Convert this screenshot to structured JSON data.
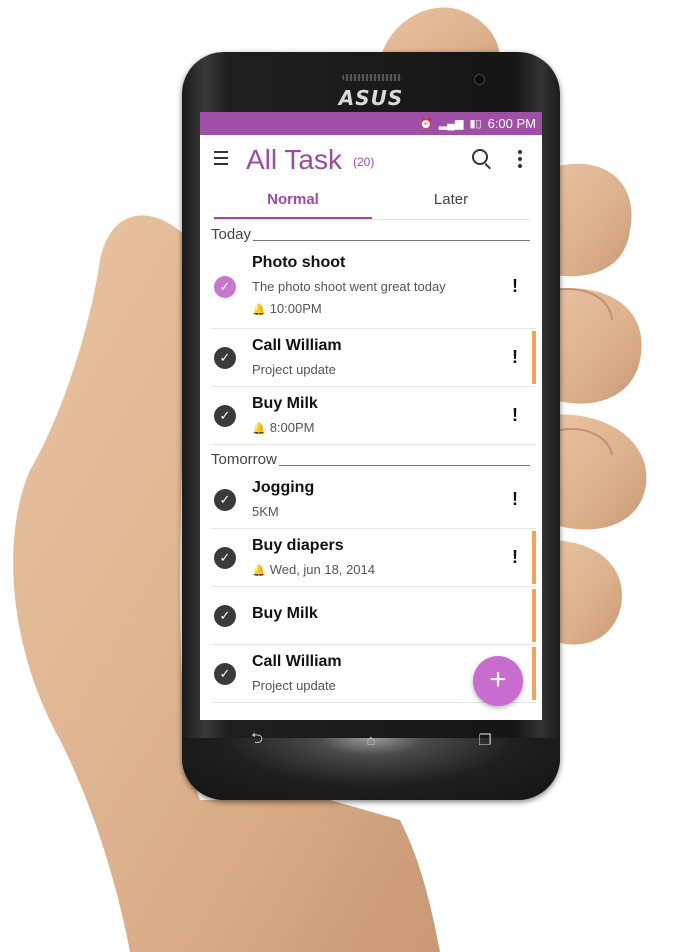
{
  "device": {
    "brand_logo": "ASUS"
  },
  "status_bar": {
    "time": "6:00 PM",
    "icons": [
      "alarm-icon",
      "signal-icon",
      "battery-icon"
    ]
  },
  "app_bar": {
    "title": "All Task",
    "count": "(20)",
    "icons": [
      "menu-icon",
      "search-icon",
      "more-icon"
    ]
  },
  "tabs": [
    {
      "label": "Normal",
      "active": true
    },
    {
      "label": "Later",
      "active": false
    }
  ],
  "sections": [
    {
      "title": "Today",
      "tasks": [
        {
          "name": "Photo shoot",
          "note": "The photo shoot went great today",
          "reminder": "10:00PM",
          "done_style": "purple",
          "flag": "!",
          "accent": false
        },
        {
          "name": "Call William",
          "note": "Project update",
          "reminder": "",
          "done_style": "dark",
          "flag": "!",
          "accent": true
        },
        {
          "name": "Buy Milk",
          "note": "",
          "reminder": "8:00PM",
          "done_style": "dark",
          "flag": "!",
          "accent": false
        }
      ]
    },
    {
      "title": "Tomorrow",
      "tasks": [
        {
          "name": "Jogging",
          "note": "5KM",
          "reminder": "",
          "done_style": "dark",
          "flag": "!",
          "accent": false
        },
        {
          "name": "Buy diapers",
          "note": "",
          "reminder": "Wed, jun 18, 2014",
          "done_style": "dark",
          "flag": "!",
          "accent": true
        },
        {
          "name": "Buy Milk",
          "note": "",
          "reminder": "",
          "done_style": "dark",
          "flag": "",
          "accent": true
        },
        {
          "name": "Call William",
          "note": "Project update",
          "reminder": "",
          "done_style": "dark",
          "flag": "!",
          "accent": true
        }
      ]
    }
  ],
  "fab": {
    "label": "+"
  },
  "nav_bar": {
    "back": "⮌",
    "home": "⌂",
    "recents": "❐"
  },
  "colors": {
    "primary": "#9d4aa3",
    "status_bar": "#a04fa6",
    "fab": "#c86ccf",
    "accent_bar": "#f5a25b"
  }
}
